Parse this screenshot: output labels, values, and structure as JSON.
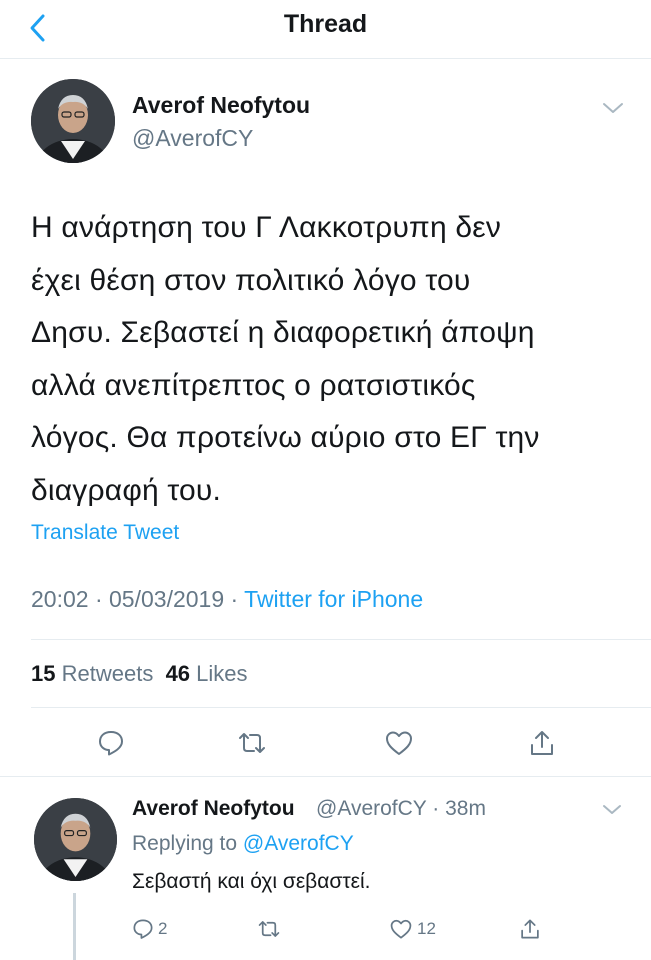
{
  "header": {
    "title": "Thread"
  },
  "main_tweet": {
    "author_name": "Averof Neofytou",
    "author_handle": "@AverofCY",
    "text_lines": [
      "Η ανάρτηση του Γ Λακκοτρυπη δεν",
      "έχει θέση στον πολιτικό λόγο του",
      "Δησυ. Σεβαστεί η διαφορετική άποψη",
      "αλλά ανεπίτρεπτος ο ρατσιστικός",
      "λόγος. Θα προτείνω αύριο στο ΕΓ την",
      "διαγραφή του."
    ],
    "translate_label": "Translate Tweet",
    "time": "20:02",
    "date": "05/03/2019",
    "source": "Twitter for iPhone",
    "retweets_count": "15",
    "retweets_label": "Retweets",
    "likes_count": "46",
    "likes_label": "Likes"
  },
  "reply_tweet": {
    "author_name": "Averof Neofytou",
    "author_handle": "@AverofCY",
    "age": "38m",
    "replying_prefix": "Replying to",
    "replying_to": "@AverofCY",
    "text": "Σεβαστή και όχι σεβαστεί.",
    "reply_count": "2",
    "like_count": "12"
  },
  "colors": {
    "accent": "#1da1f2",
    "secondary_text": "#657786",
    "primary_text": "#14171a",
    "divider": "#e6ecf0"
  },
  "icons": {
    "back": "chevron-left-icon",
    "menu": "chevron-down-icon",
    "reply": "speech-bubble-icon",
    "retweet": "retweet-icon",
    "like": "heart-icon",
    "share": "share-icon"
  }
}
